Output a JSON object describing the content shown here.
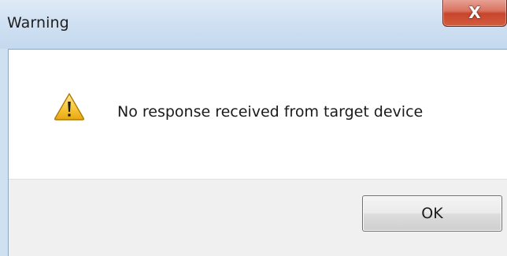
{
  "window": {
    "title": "Warning",
    "close_icon": "close-icon",
    "close_glyph": "X"
  },
  "message": {
    "icon": "warning-icon",
    "text": "No response received from target device"
  },
  "buttons": {
    "ok_label": "OK"
  },
  "colors": {
    "titlebar": "#cfe0f1",
    "close_button": "#c7452c",
    "button_area": "#f0f0f0",
    "warning_fill": "#f7c83a"
  }
}
